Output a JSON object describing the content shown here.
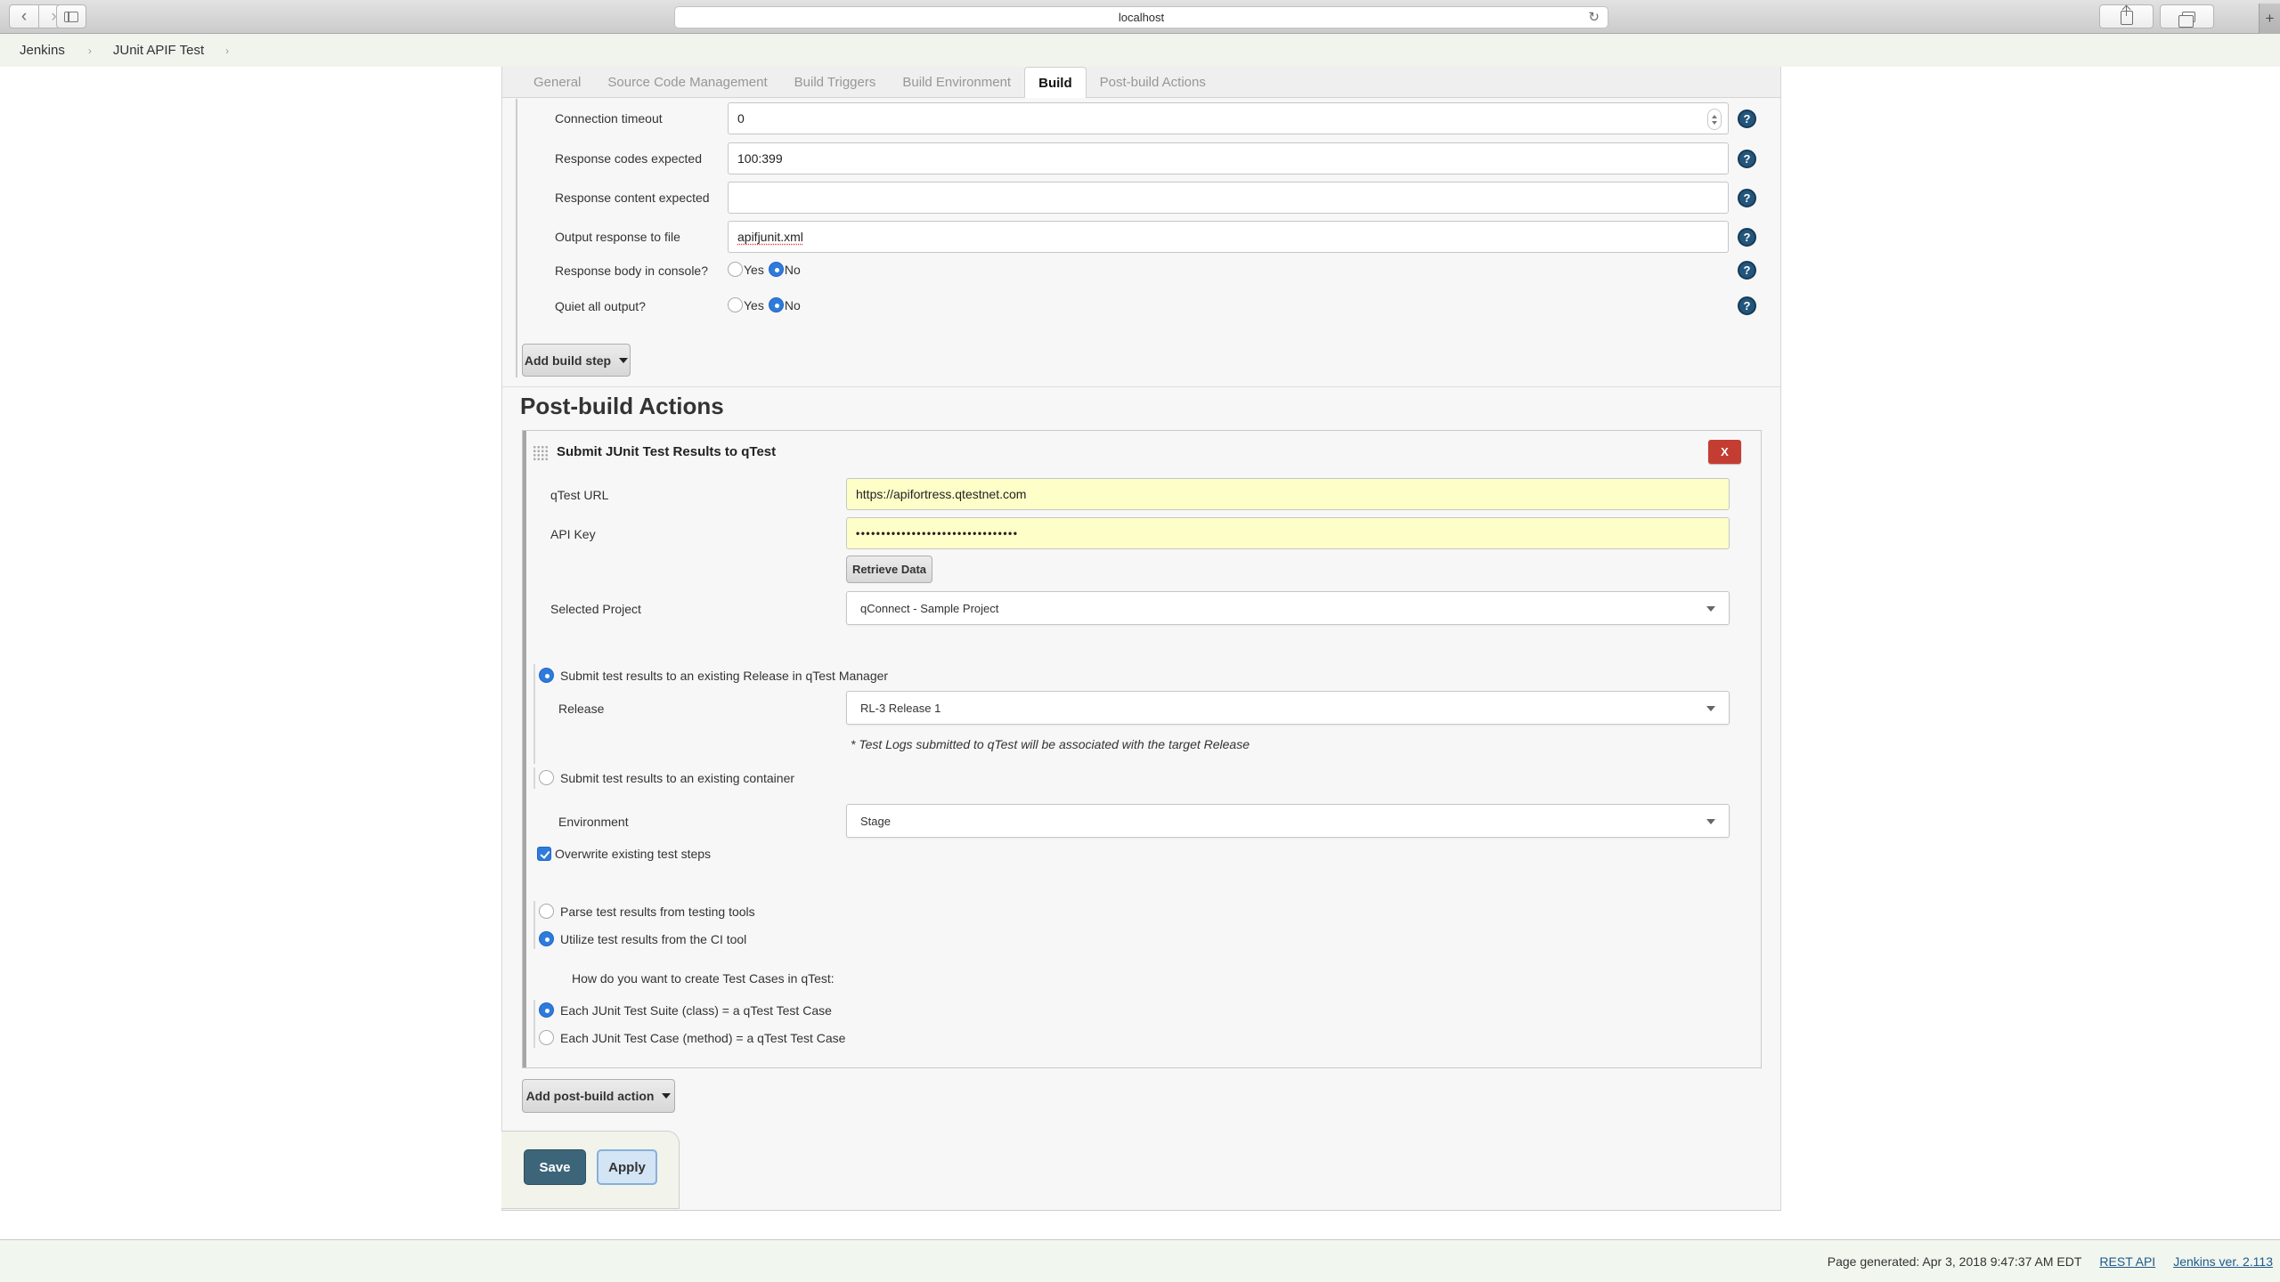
{
  "browser": {
    "back_glyph": "‹",
    "forward_glyph": "›",
    "url": "localhost",
    "reload_glyph": "↻",
    "newtab_glyph": "+"
  },
  "breadcrumb": {
    "items": [
      {
        "label": "Jenkins"
      },
      {
        "label": "JUnit APIF Test"
      }
    ],
    "separator": "›"
  },
  "tabs": {
    "active": "Build",
    "items": [
      {
        "label": "General"
      },
      {
        "label": "Source Code Management"
      },
      {
        "label": "Build Triggers"
      },
      {
        "label": "Build Environment"
      },
      {
        "label": "Build"
      },
      {
        "label": "Post-build Actions"
      }
    ]
  },
  "ui": {
    "help_glyph": "?"
  },
  "build": {
    "yes_label": "Yes",
    "no_label": "No",
    "rows": [
      {
        "label": "Connection timeout",
        "value": "0"
      },
      {
        "label": "Response codes expected",
        "value": "100:399"
      },
      {
        "label": "Response content expected",
        "value": ""
      },
      {
        "label": "Output response to file",
        "value": "apifjunit.xml"
      },
      {
        "label": "Response body in console?",
        "selected": "No"
      },
      {
        "label": "Quiet all output?",
        "selected": "No"
      }
    ],
    "add_button": "Add build step"
  },
  "postbuild": {
    "heading": "Post-build Actions",
    "item": {
      "title": "Submit JUnit Test Results to qTest",
      "close_label": "X",
      "qtest_url_label": "qTest URL",
      "qtest_url": "https://apifortress.qtestnet.com",
      "api_key_label": "API Key",
      "api_key_masked": "••••••••••••••••••••••••••••••••",
      "retrieve_button": "Retrieve Data",
      "selected_project_label": "Selected Project",
      "selected_project": "qConnect - Sample Project",
      "release_option": "Submit test results to an existing Release in qTest Manager",
      "release_option_selected": true,
      "release_label": "Release",
      "release": "RL-3 Release 1",
      "release_note": "* Test Logs submitted to qTest will be associated with the target Release",
      "container_option": "Submit test results to an existing container",
      "container_option_selected": false,
      "environment_label": "Environment",
      "environment": "Stage",
      "overwrite_label": "Overwrite existing test steps",
      "overwrite_checked": true,
      "parse_option": "Parse test results from testing tools",
      "parse_option_selected": false,
      "utilize_option": "Utilize test results from the CI tool",
      "utilize_option_selected": true,
      "how_label": "How do you want to create Test Cases in qTest:",
      "suite_option": "Each JUnit Test Suite (class) = a qTest Test Case",
      "suite_option_selected": true,
      "case_option": "Each JUnit Test Case (method) = a qTest Test Case",
      "case_option_selected": false
    },
    "add_button": "Add post-build action"
  },
  "actions": {
    "save": "Save",
    "apply": "Apply"
  },
  "footer": {
    "generated": "Page generated: Apr 3, 2018 9:47:37 AM EDT",
    "rest_api": "REST API",
    "version": "Jenkins ver. 2.113"
  },
  "colors": {
    "accent_blue": "#2e7bdb",
    "field_yellow": "#feffc8",
    "danger_red": "#c43d33",
    "save_teal": "#3d6579",
    "footer_green": "#f1f6ee"
  }
}
